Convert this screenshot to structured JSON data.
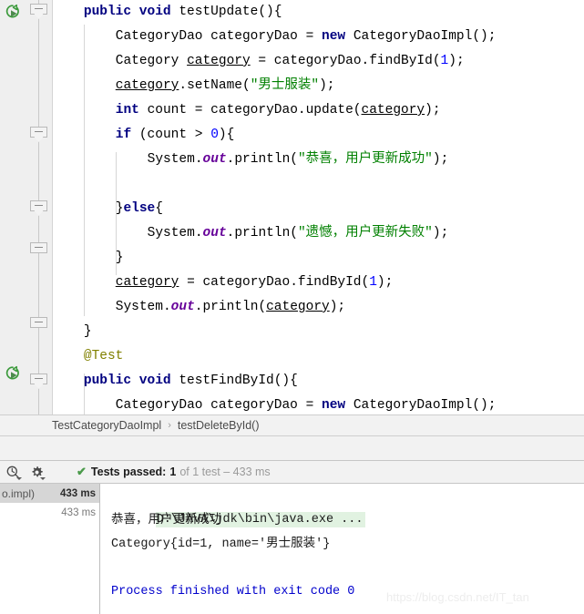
{
  "editor": {
    "lines": [
      {
        "indent": 1,
        "segments": [
          {
            "t": "public ",
            "c": "kw"
          },
          {
            "t": "void ",
            "c": "kw"
          },
          {
            "t": "testUpdate(){",
            "c": "plain"
          }
        ]
      },
      {
        "indent": 2,
        "segments": [
          {
            "t": "CategoryDao categoryDao = ",
            "c": "plain"
          },
          {
            "t": "new ",
            "c": "kw"
          },
          {
            "t": "CategoryDaoImpl();",
            "c": "plain"
          }
        ]
      },
      {
        "indent": 2,
        "segments": [
          {
            "t": "Category ",
            "c": "plain"
          },
          {
            "t": "category",
            "c": "lv"
          },
          {
            "t": " = categoryDao.findById(",
            "c": "plain"
          },
          {
            "t": "1",
            "c": "num"
          },
          {
            "t": ");",
            "c": "plain"
          }
        ]
      },
      {
        "indent": 2,
        "segments": [
          {
            "t": "category",
            "c": "lv"
          },
          {
            "t": ".setName(",
            "c": "plain"
          },
          {
            "t": "\"男士服装\"",
            "c": "str"
          },
          {
            "t": ");",
            "c": "plain"
          }
        ]
      },
      {
        "indent": 2,
        "segments": [
          {
            "t": "int ",
            "c": "kw"
          },
          {
            "t": "count = categoryDao.update(",
            "c": "plain"
          },
          {
            "t": "category",
            "c": "lv"
          },
          {
            "t": ");",
            "c": "plain"
          }
        ]
      },
      {
        "indent": 2,
        "segments": [
          {
            "t": "if ",
            "c": "kw"
          },
          {
            "t": "(count > ",
            "c": "plain"
          },
          {
            "t": "0",
            "c": "num"
          },
          {
            "t": "){",
            "c": "plain"
          }
        ]
      },
      {
        "indent": 3,
        "segments": [
          {
            "t": "System.",
            "c": "plain"
          },
          {
            "t": "out",
            "c": "field"
          },
          {
            "t": ".println(",
            "c": "plain"
          },
          {
            "t": "\"恭喜，用户更新成功\"",
            "c": "str"
          },
          {
            "t": ");",
            "c": "plain"
          }
        ]
      },
      {
        "indent": 0,
        "segments": []
      },
      {
        "indent": 2,
        "segments": [
          {
            "t": "}",
            "c": "plain"
          },
          {
            "t": "else",
            "c": "kw"
          },
          {
            "t": "{",
            "c": "plain"
          }
        ]
      },
      {
        "indent": 3,
        "segments": [
          {
            "t": "System.",
            "c": "plain"
          },
          {
            "t": "out",
            "c": "field"
          },
          {
            "t": ".println(",
            "c": "plain"
          },
          {
            "t": "\"遗憾，用户更新失败\"",
            "c": "str"
          },
          {
            "t": ");",
            "c": "plain"
          }
        ]
      },
      {
        "indent": 2,
        "segments": [
          {
            "t": "}",
            "c": "plain"
          }
        ]
      },
      {
        "indent": 2,
        "segments": [
          {
            "t": "category",
            "c": "lv"
          },
          {
            "t": " = categoryDao.findById(",
            "c": "plain"
          },
          {
            "t": "1",
            "c": "num"
          },
          {
            "t": ");",
            "c": "plain"
          }
        ]
      },
      {
        "indent": 2,
        "segments": [
          {
            "t": "System.",
            "c": "plain"
          },
          {
            "t": "out",
            "c": "field"
          },
          {
            "t": ".println(",
            "c": "plain"
          },
          {
            "t": "category",
            "c": "lv"
          },
          {
            "t": ");",
            "c": "plain"
          }
        ]
      },
      {
        "indent": 1,
        "segments": [
          {
            "t": "}",
            "c": "plain"
          }
        ]
      },
      {
        "indent": 1,
        "segments": [
          {
            "t": "@Test",
            "c": "anno"
          }
        ]
      },
      {
        "indent": 1,
        "segments": [
          {
            "t": "public ",
            "c": "kw"
          },
          {
            "t": "void ",
            "c": "kw"
          },
          {
            "t": "testFindById(){",
            "c": "plain"
          }
        ]
      },
      {
        "indent": 2,
        "segments": [
          {
            "t": "CategoryDao categoryDao = ",
            "c": "plain"
          },
          {
            "t": "new ",
            "c": "kw"
          },
          {
            "t": "CategoryDaoImpl();",
            "c": "plain"
          }
        ]
      }
    ]
  },
  "breadcrumb": {
    "class_name": "TestCategoryDaoImpl",
    "separator": "›",
    "method_name": "testDeleteById()"
  },
  "statusbar": {
    "check_glyph": "✔",
    "passed_label": "Tests passed:",
    "passed_count": "1",
    "detail": "of 1 test – 433 ms",
    "history_icon": "history-icon",
    "settings_icon": "gear-icon"
  },
  "tree": {
    "rows": [
      {
        "label": "o.impl)",
        "time": "433 ms",
        "selected": true
      },
      {
        "label": "",
        "time": "433 ms",
        "selected": false
      }
    ]
  },
  "console": {
    "command": "D:\\JAVA\\jdk\\bin\\java.exe ...",
    "output_1": "恭喜，用户更新成功",
    "output_2": "Category{id=1, name='男士服装'}",
    "blank": "",
    "finished": "Process finished with exit code 0"
  },
  "watermark": {
    "text": "https://blog.csdn.net/IT_tan"
  },
  "colors": {
    "keyword": "#000080",
    "string": "#008000",
    "number": "#0000ff",
    "annotation": "#808000",
    "static_field": "#660099",
    "console_blue": "#0000cc",
    "pass_green": "#4a9a4a",
    "cmd_highlight": "#e1f2e1"
  }
}
